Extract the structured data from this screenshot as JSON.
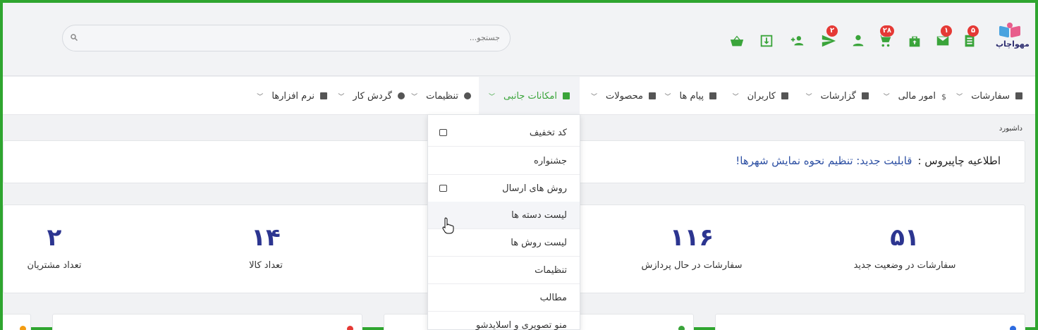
{
  "header": {
    "logo_text": "مهواچاپ",
    "search_placeholder": "جستجو...",
    "icons": [
      {
        "name": "orders-list-icon",
        "badge": "۵"
      },
      {
        "name": "mail-icon",
        "badge": "۱"
      },
      {
        "name": "shopping-bag-icon",
        "badge": ""
      },
      {
        "name": "cart-icon",
        "badge": "۲۸"
      },
      {
        "name": "user-icon",
        "badge": ""
      },
      {
        "name": "send-icon",
        "badge": "۲"
      },
      {
        "name": "add-user-icon",
        "badge": ""
      },
      {
        "name": "download-icon",
        "badge": ""
      },
      {
        "name": "basket-icon",
        "badge": ""
      }
    ]
  },
  "nav": {
    "items": [
      {
        "label": "سفارشات",
        "icon": "cart-icon"
      },
      {
        "label": "امور مالی",
        "icon": "dollar-icon"
      },
      {
        "label": "گزارشات",
        "icon": "chart-icon"
      },
      {
        "label": "کاربران",
        "icon": "user-icon"
      },
      {
        "label": "پیام ها",
        "icon": "message-icon"
      },
      {
        "label": "محصولات",
        "icon": "store-icon"
      },
      {
        "label": "امکانات جانبی",
        "icon": "grid-icon"
      },
      {
        "label": "تنظیمات",
        "icon": "gear-icon"
      },
      {
        "label": "گردش کار",
        "icon": "workflow-icon"
      },
      {
        "label": "نرم افزارها",
        "icon": "apps-icon"
      }
    ]
  },
  "dropdown": {
    "items": [
      {
        "label": "کد تخفیف",
        "icon": "image-icon"
      },
      {
        "label": "جشنواره",
        "icon": ""
      },
      {
        "label": "روش های ارسال",
        "icon": "shipping-icon"
      },
      {
        "label": "لیست دسته ها",
        "icon": ""
      },
      {
        "label": "لیست روش ها",
        "icon": ""
      },
      {
        "label": "تنظیمات",
        "icon": ""
      },
      {
        "label": "مطالب",
        "icon": ""
      },
      {
        "label": "منو تصویری و اسلایدشو",
        "icon": ""
      }
    ]
  },
  "breadcrumb": "داشبورد",
  "notice": {
    "title": "اطلاعیه چاپیروس :",
    "link": "قابلیت جدید: تنظیم نحوه نمایش شهرها!"
  },
  "stats": [
    {
      "value": "۵۱",
      "label": "سفارشات در وضعیت جدید"
    },
    {
      "value": "۱۱۶",
      "label": "سفارشات در حال پردازش"
    },
    {
      "value": "۱۴",
      "label": "تعداد کالا"
    },
    {
      "value": "۲",
      "label": "تعداد مشتریان"
    }
  ],
  "colors": {
    "accent": "#3aa43a",
    "number": "#2c3590",
    "badge": "#e53935",
    "link": "#2c4fa3"
  }
}
